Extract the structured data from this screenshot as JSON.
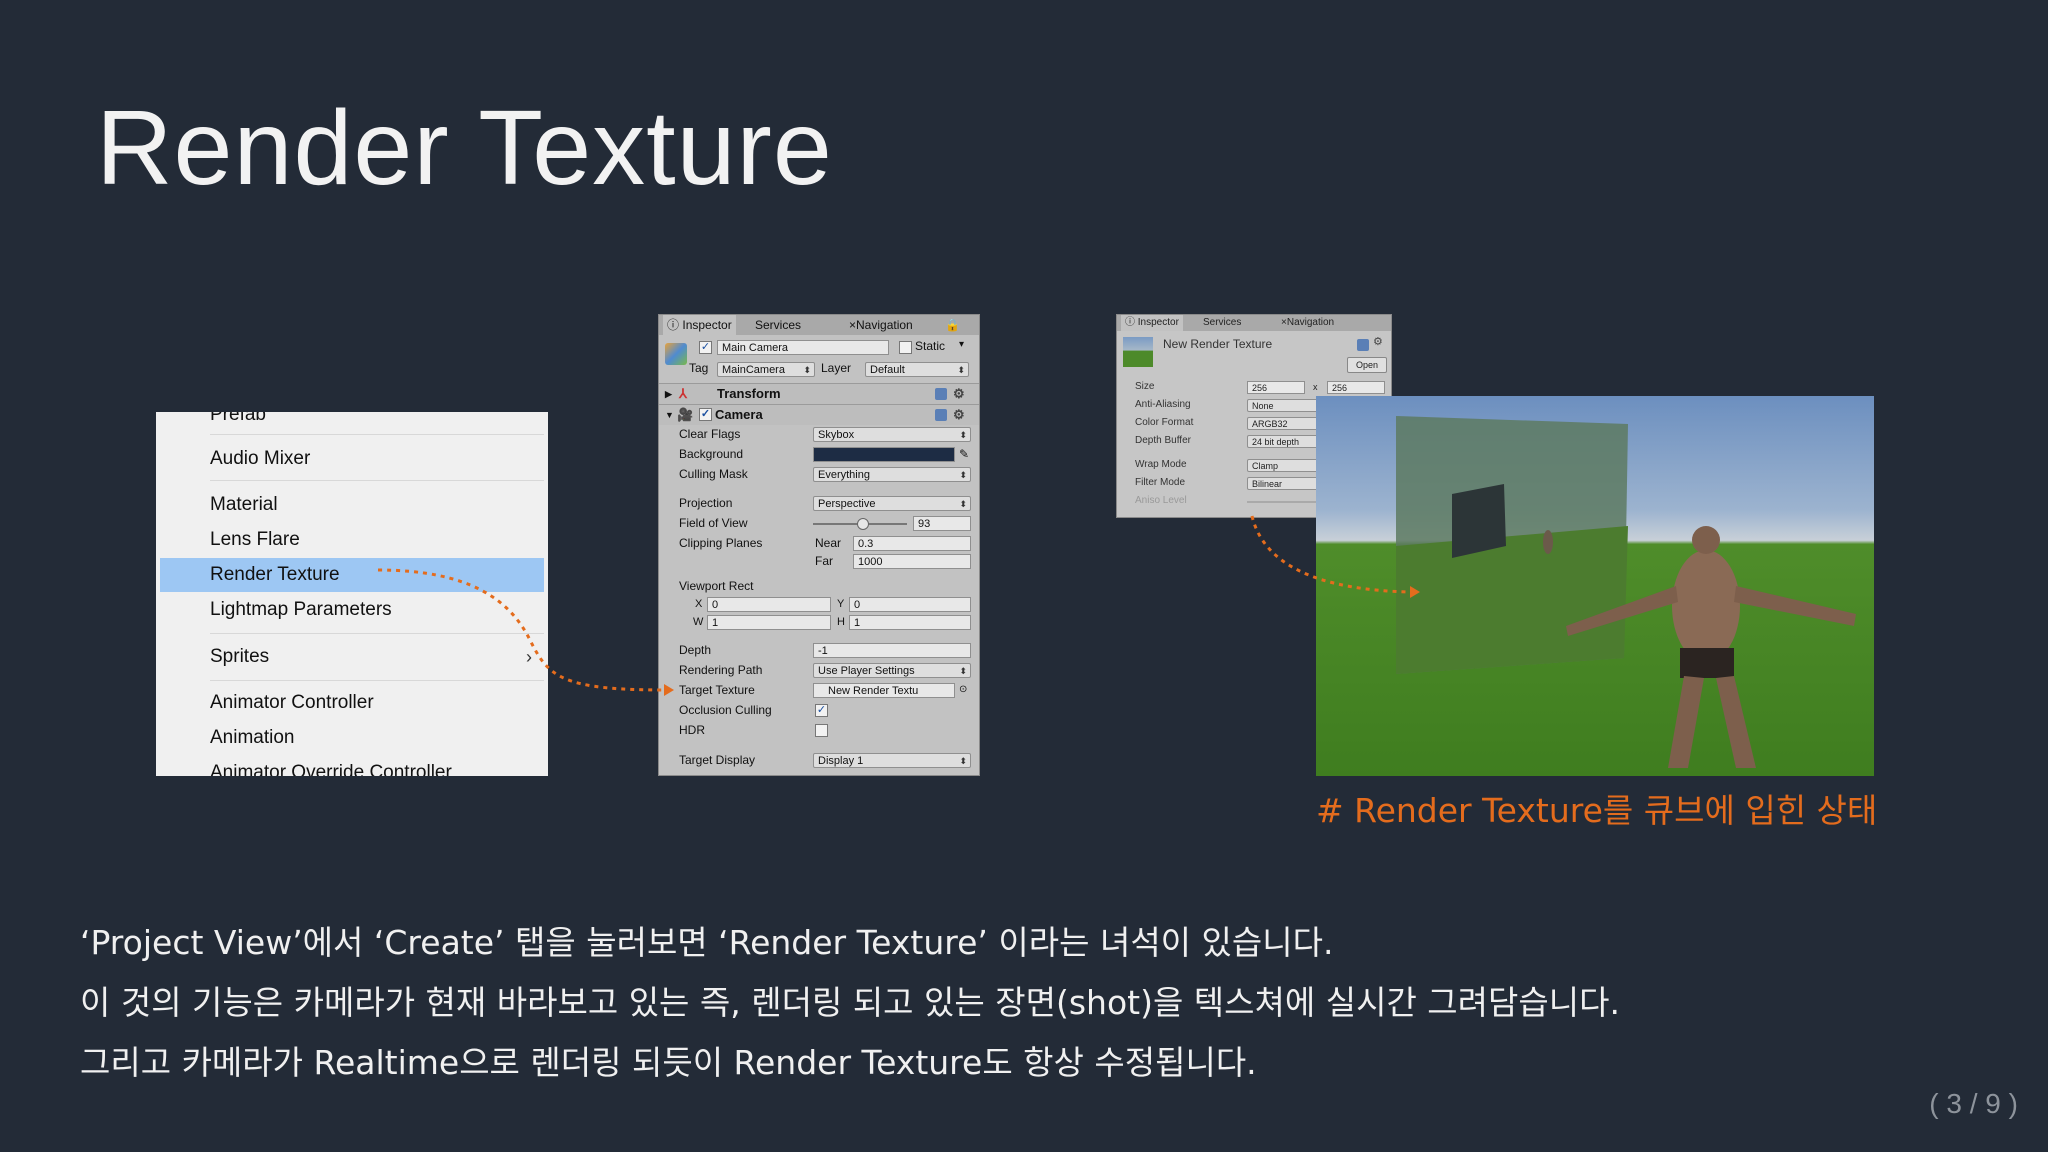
{
  "slide": {
    "title": "Render Texture",
    "caption": "# Render Texture를 큐브에 입힌 상태",
    "paragraphs": [
      "‘Project View’에서 ‘Create’ 탭을 눌러보면 ‘Render Texture’ 이라는 녀석이 있습니다.",
      "이 것의 기능은 카메라가 현재 바라보고 있는 즉, 렌더링 되고 있는 장면(shot)을 텍스쳐에 실시간 그려담습니다.",
      "그리고 카메라가 Realtime으로 렌더링 되듯이 Render Texture도 항상 수정됩니다."
    ],
    "page": "( 3 / 9 )",
    "accent_color": "#e46c1d"
  },
  "create_menu": {
    "items": [
      "Prefab",
      "Audio Mixer",
      "Material",
      "Lens Flare",
      "Render Texture",
      "Lightmap Parameters",
      "Sprites",
      "Animator Controller",
      "Animation",
      "Animator Override Controller"
    ],
    "selected": "Render Texture"
  },
  "camera_inspector": {
    "tabs": [
      "Inspector",
      "Services",
      "Navigation"
    ],
    "object_name": "Main Camera",
    "static_label": "Static",
    "tag_label": "Tag",
    "tag_value": "MainCamera",
    "layer_label": "Layer",
    "layer_value": "Default",
    "transform_label": "Transform",
    "camera_label": "Camera",
    "fields": {
      "clear_flags": {
        "label": "Clear Flags",
        "value": "Skybox"
      },
      "background": {
        "label": "Background",
        "color": "#1d2c44"
      },
      "culling_mask": {
        "label": "Culling Mask",
        "value": "Everything"
      },
      "projection": {
        "label": "Projection",
        "value": "Perspective"
      },
      "fov": {
        "label": "Field of View",
        "value": "93"
      },
      "clipping": {
        "label": "Clipping Planes",
        "near_label": "Near",
        "near": "0.3",
        "far_label": "Far",
        "far": "1000"
      },
      "viewport": {
        "label": "Viewport Rect",
        "x_label": "X",
        "x": "0",
        "y_label": "Y",
        "y": "0",
        "w_label": "W",
        "w": "1",
        "h_label": "H",
        "h": "1"
      },
      "depth": {
        "label": "Depth",
        "value": "-1"
      },
      "rendering_path": {
        "label": "Rendering Path",
        "value": "Use Player Settings"
      },
      "target_texture": {
        "label": "Target Texture",
        "value": "New Render Textu"
      },
      "occlusion": {
        "label": "Occlusion Culling",
        "checked": true
      },
      "hdr": {
        "label": "HDR",
        "checked": false
      },
      "target_display": {
        "label": "Target Display",
        "value": "Display 1"
      }
    }
  },
  "texture_inspector": {
    "tabs": [
      "Inspector",
      "Services",
      "Navigation"
    ],
    "name": "New Render Texture",
    "open_label": "Open",
    "size_label": "Size",
    "size_w": "256",
    "size_x": "x",
    "size_h": "256",
    "anti_aliasing": {
      "label": "Anti-Aliasing",
      "value": "None"
    },
    "color_format": {
      "label": "Color Format",
      "value": "ARGB32"
    },
    "depth_buffer": {
      "label": "Depth Buffer",
      "value": "24 bit depth"
    },
    "wrap_mode": {
      "label": "Wrap Mode",
      "value": "Clamp"
    },
    "filter_mode": {
      "label": "Filter Mode",
      "value": "Bilinear"
    },
    "aniso": {
      "label": "Aniso Level",
      "value": "0"
    }
  }
}
